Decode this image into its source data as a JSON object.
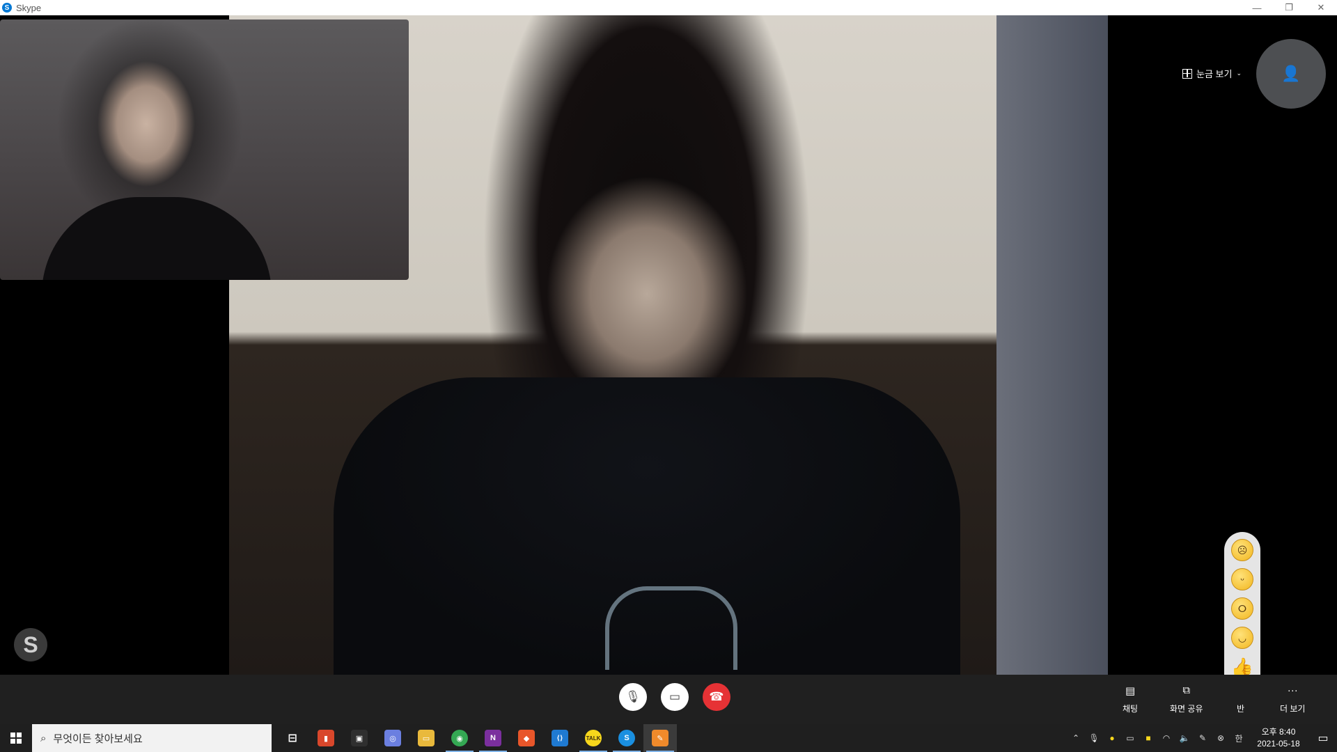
{
  "window": {
    "app_icon": "S",
    "title": "Skype",
    "controls": {
      "minimize": "—",
      "restore": "❐",
      "close": "✕"
    }
  },
  "call": {
    "watermark": "S",
    "grid_view_label": "눈금 보기",
    "add_person_icon": "add-person-icon"
  },
  "reactions": [
    {
      "name": "sad-emoji-icon",
      "glyph": "☹"
    },
    {
      "name": "yawn-emoji-icon",
      "glyph": "ᵕ"
    },
    {
      "name": "surprised-emoji-icon",
      "glyph": "ⵔ"
    },
    {
      "name": "laugh-emoji-icon",
      "glyph": "◡"
    },
    {
      "name": "thumbs-up-icon",
      "glyph": "👍"
    },
    {
      "name": "heart-icon",
      "glyph": "♥"
    }
  ],
  "controls": {
    "mic_icon": "🎙",
    "video_icon": "▭",
    "hangup_icon": "☎",
    "chat_label": "채팅",
    "share_label": "화면 공유",
    "react_label": "반",
    "more_label": "더 보기",
    "chat_icon": "▤",
    "share_icon": "⧉",
    "more_icon": "···"
  },
  "taskbar": {
    "search_placeholder": "무엇이든 찾아보세요",
    "apps": [
      {
        "name": "task-view-icon",
        "label": "⊟",
        "color": "#1f1f1f"
      },
      {
        "name": "app-red-icon",
        "label": "▮",
        "color": "#d9472b"
      },
      {
        "name": "store-icon",
        "label": "▣",
        "color": "#2f2f2f"
      },
      {
        "name": "app-blue-icon",
        "label": "◎",
        "color": "#6b7fe0"
      },
      {
        "name": "file-explorer-icon",
        "label": "▭",
        "color": "#e9b93c"
      },
      {
        "name": "chrome-icon",
        "label": "◉",
        "color": "#34a853"
      },
      {
        "name": "onenote-icon",
        "label": "N",
        "color": "#7b2f9e"
      },
      {
        "name": "app-orange-icon",
        "label": "◆",
        "color": "#e8562a"
      },
      {
        "name": "vscode-icon",
        "label": "⟨⟩",
        "color": "#1f7ad2"
      },
      {
        "name": "kakaotalk-icon",
        "label": "TALK",
        "color": "#f7d71c"
      },
      {
        "name": "skype-taskbar-icon",
        "label": "S",
        "color": "#1a8fe0"
      },
      {
        "name": "app-paint-icon",
        "label": "✎",
        "color": "#f08a2b"
      }
    ],
    "clock_time": "오후 8:40",
    "clock_date": "2021-05-18",
    "ime": "한"
  }
}
